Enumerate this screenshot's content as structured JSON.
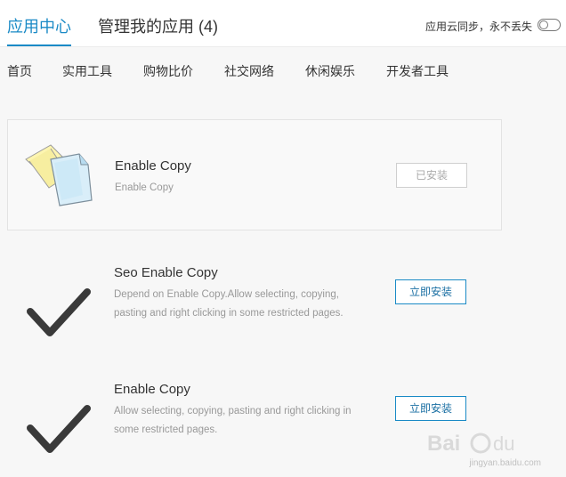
{
  "header": {
    "tab_app_center": "应用中心",
    "tab_manage": "管理我的应用 (4)",
    "sync_label": "应用云同步，永不丢失",
    "sync_enabled": false
  },
  "nav": {
    "items": [
      "首页",
      "实用工具",
      "购物比价",
      "社交网络",
      "休闲娱乐",
      "开发者工具"
    ]
  },
  "apps": [
    {
      "title": "Enable Copy",
      "desc": "Enable Copy",
      "button": "已安装",
      "icon": "documents-icon",
      "installed": true
    },
    {
      "title": "Seo Enable Copy",
      "desc": "Depend on Enable Copy.Allow selecting, copying, pasting and right clicking in some restricted pages.",
      "button": "立即安装",
      "icon": "checkmark-icon",
      "installed": false
    },
    {
      "title": "Enable Copy",
      "desc": "Allow selecting, copying, pasting and right clicking in some restricted pages.",
      "button": "立即安装",
      "icon": "checkmark-icon",
      "installed": false
    }
  ],
  "watermark": {
    "text": "jingyan.baidu.com"
  },
  "colors": {
    "accent": "#1a8ac6",
    "background": "#f7f7f7"
  }
}
